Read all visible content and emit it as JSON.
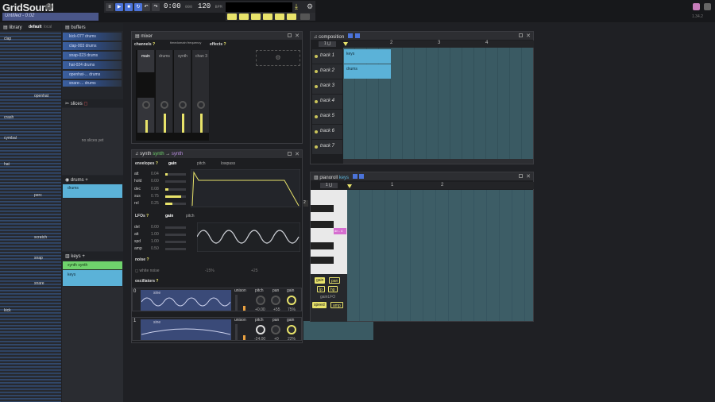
{
  "app": {
    "title": "GridSound",
    "badge": "2",
    "project": "Untitled",
    "project_tail": " - 0:02",
    "version": "1.34.2"
  },
  "transport": {
    "time": "0:00",
    "time_small": "000",
    "bpm": "120",
    "bpm_unit": "BPM"
  },
  "library": {
    "title": "library",
    "tab_default": "default",
    "tab_local": "local",
    "samples": [
      "clap",
      "openhat",
      "crash",
      "cymbal",
      "hat",
      "perc",
      "scratch",
      "snap",
      "snare",
      "kick"
    ]
  },
  "buffers": {
    "title": "buffers",
    "items": [
      {
        "name": "kick-077",
        "tag": "drums"
      },
      {
        "name": "clap-003",
        "tag": "drums"
      },
      {
        "name": "snap-023",
        "tag": "drums"
      },
      {
        "name": "hat-024",
        "tag": "drums"
      },
      {
        "name": "openhat-...",
        "tag": "drums"
      },
      {
        "name": "snare-...",
        "tag": "drums"
      }
    ]
  },
  "slices": {
    "title": "slices",
    "empty": "no slices yet"
  },
  "drums": {
    "title": "drums",
    "items": [
      "drums"
    ]
  },
  "keys": {
    "title": "keys",
    "items": [
      {
        "name": "synth",
        "tag": "synth"
      },
      {
        "name": "keys"
      }
    ]
  },
  "mixer": {
    "title": "mixer",
    "channels_label": "channels",
    "effects_label": "effects",
    "effect_hint": "timedomain frequency",
    "channels": [
      "main",
      "drums",
      "synth",
      "chan 3"
    ]
  },
  "synth": {
    "title": "synth",
    "tag": "synth",
    "target": "synth",
    "envelopes": {
      "label": "envelopes",
      "tab_gain": "gain",
      "tab_pitch": "pitch",
      "tab_lowpass": "lowpass",
      "rows": [
        {
          "name": "att",
          "value": "0.04",
          "level": 0.1
        },
        {
          "name": "hold",
          "value": "0.00",
          "level": 0
        },
        {
          "name": "dec",
          "value": "0.08",
          "level": 0.15
        },
        {
          "name": "sus",
          "value": "0.75",
          "level": 0.75
        },
        {
          "name": "rel",
          "value": "0.25",
          "level": 0.35
        }
      ]
    },
    "lfos": {
      "label": "LFOs",
      "tab_gain": "gain",
      "tab_pitch": "pitch",
      "rows": [
        {
          "name": "del",
          "value": "0.00"
        },
        {
          "name": "att",
          "value": "1.00"
        },
        {
          "name": "spd",
          "value": "1.00"
        },
        {
          "name": "amp",
          "value": "0.50"
        }
      ]
    },
    "noise": {
      "label": "noise",
      "item": "white noise",
      "gain": "-15%",
      "pan": "+25"
    },
    "oscillators": {
      "label": "oscillators",
      "items": [
        {
          "index": "0",
          "wave": "sine",
          "unison": "unison",
          "pitch": "pitch",
          "pan": "pan",
          "gain": "gain",
          "pitch_val": "+0.00",
          "pan_val": "+55",
          "gain_val": "75%"
        },
        {
          "index": "1",
          "wave": "sine",
          "unison": "unison",
          "pitch": "pitch",
          "pan": "pan",
          "gain": "gain",
          "pitch_val": "-24.00",
          "pan_val": "+0",
          "gain_val": "22%"
        }
      ]
    }
  },
  "composition": {
    "title": "composition",
    "ruler": [
      "1",
      "2",
      "3",
      "4"
    ],
    "tracks": [
      "track 1",
      "track 2",
      "track 3",
      "track 4",
      "track 5",
      "track 6",
      "track 7"
    ],
    "clips": [
      {
        "label": "keys"
      },
      {
        "label": "drums"
      }
    ]
  },
  "pianoroll": {
    "title": "pianoroll",
    "tag": "keys",
    "ruler": [
      "1",
      "2"
    ],
    "note_label": "dn - 4",
    "props": [
      "gain",
      "pan",
      "lp",
      "hp"
    ],
    "lfo_label": "gainLFO",
    "lfo_props": [
      "speed",
      "amp"
    ]
  },
  "colors": {
    "accent": "#e8e36a",
    "blue": "#4b73d9",
    "grid": "#3a5a63",
    "clip": "#5bb2d8"
  }
}
